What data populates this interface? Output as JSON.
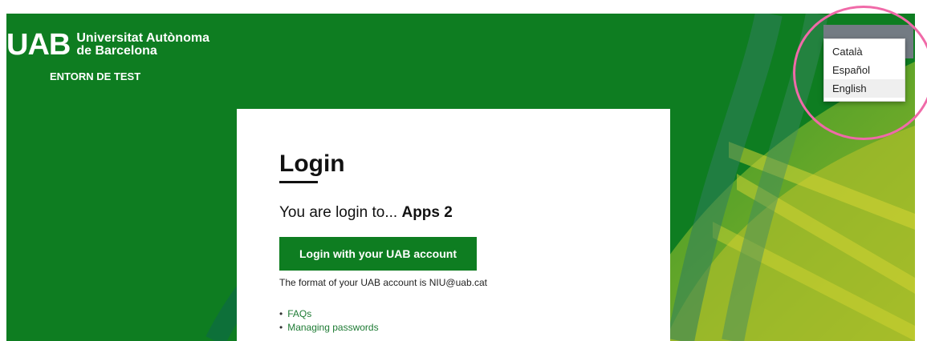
{
  "brand": {
    "logo_mark": "UAB",
    "name_line1": "Universitat Autònoma",
    "name_line2": "de Barcelona",
    "environment": "ENTORN DE TEST"
  },
  "language_menu": {
    "options": [
      "Català",
      "Español",
      "English"
    ],
    "selected": "English"
  },
  "login": {
    "title": "Login",
    "subtitle_prefix": "You are login to...",
    "app_name": "Apps 2",
    "button_label": "Login with your UAB account",
    "hint": "The format of your UAB account is NIU@uab.cat",
    "links": [
      "FAQs",
      "Managing passwords"
    ]
  },
  "colors": {
    "brand_green": "#0e7d21",
    "annotation": "#f06aa8"
  }
}
